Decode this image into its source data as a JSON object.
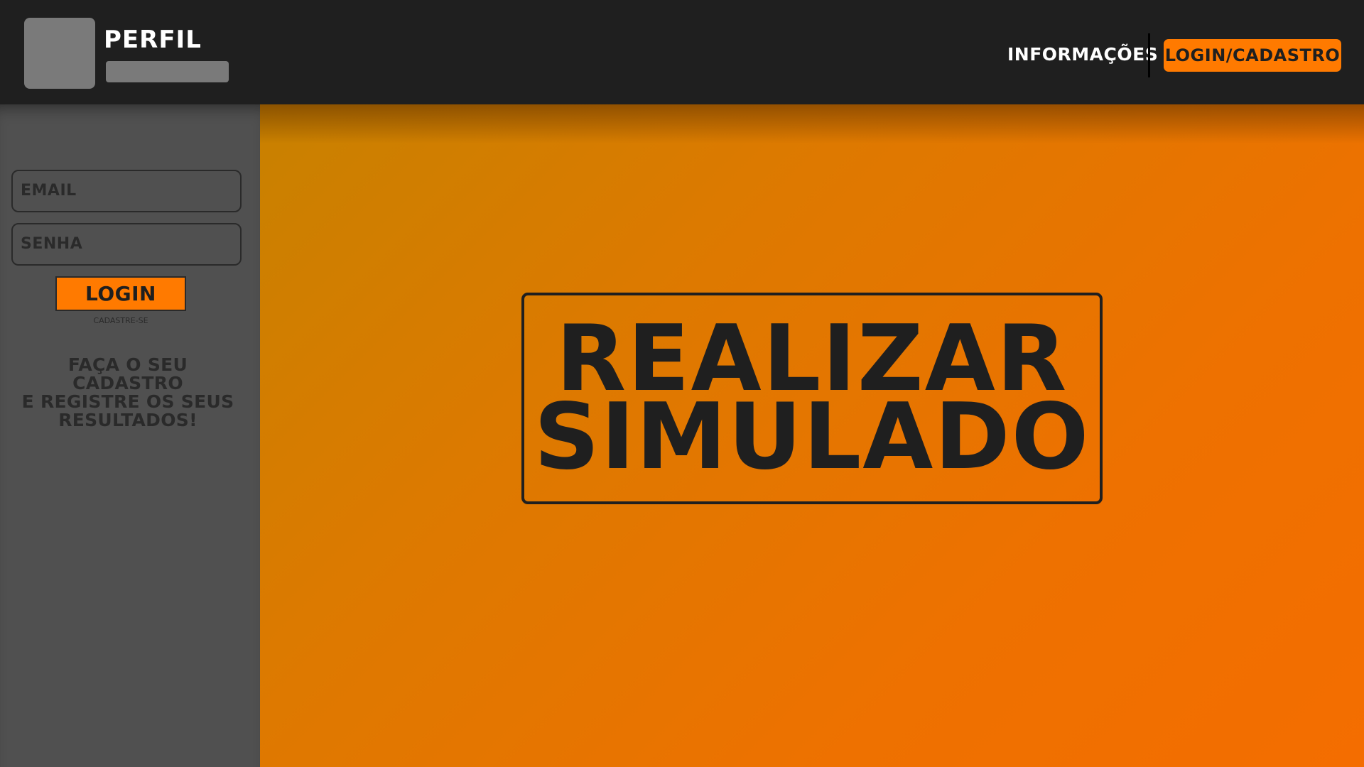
{
  "header": {
    "profile_title": "Perfil",
    "nav_info_label": "Informações",
    "nav_login_label": "Login/Cadastro"
  },
  "sidebar": {
    "email_placeholder": "Email",
    "password_placeholder": "Senha",
    "login_label": "Login",
    "signup_link": "Cadastre-se",
    "message_lines": [
      "Faça o seu cadastro",
      "e registre os seus",
      "resultados!"
    ]
  },
  "main": {
    "cta_lines": [
      "Realizar",
      "Simulado"
    ]
  },
  "colors": {
    "accent": "#ff7a00",
    "header_bg": "#1f1f1f",
    "sidebar_bg": "#505050",
    "text_dark": "#1f1f1f"
  },
  "icons": {
    "avatar": "avatar-placeholder"
  }
}
